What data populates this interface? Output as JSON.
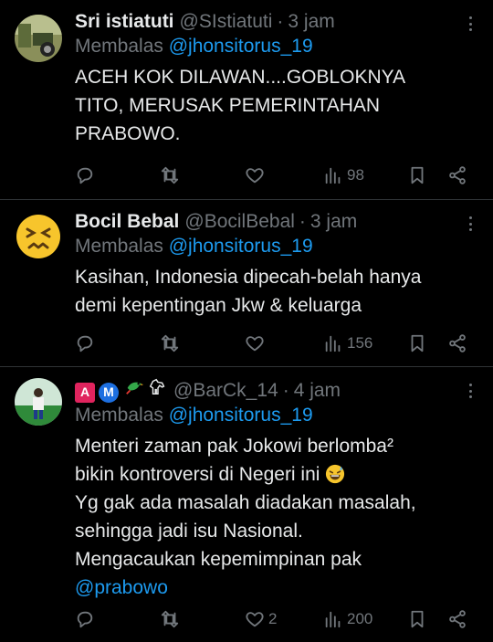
{
  "tweets": [
    {
      "name": "Sri istiatuti",
      "handle": "@SIstiatuti",
      "time": "3 jam",
      "reply_prefix": "Membalas",
      "reply_to": "@jhonsitorus_19",
      "text": "ACEH KOK DILAWAN....GOBLOKNYA\nTITO, MERUSAK PEMERINTAHAN\nPRABOWO.",
      "views": "98",
      "likes": ""
    },
    {
      "name": "Bocil Bebal",
      "handle": "@BocilBebal",
      "time": "3 jam",
      "reply_prefix": "Membalas",
      "reply_to": "@jhonsitorus_19",
      "text": "Kasihan, Indonesia dipecah-belah hanya\ndemi kepentingan Jkw & keluarga",
      "views": "156",
      "likes": ""
    },
    {
      "name_badges": [
        "A",
        "M"
      ],
      "handle": "@BarCk_14",
      "time": "4 jam",
      "reply_prefix": "Membalas",
      "reply_to": "@jhonsitorus_19",
      "text_lines": [
        "Menteri zaman pak Jokowi berlomba²",
        "bikin kontroversi di Negeri ini",
        "Yg gak ada masalah diadakan masalah,",
        "sehingga jadi isu Nasional.",
        "Mengacaukan kepemimpinan pak"
      ],
      "mention": "@prabowo",
      "views": "200",
      "likes": "2"
    }
  ],
  "icons": [
    "reply-icon",
    "retweet-icon",
    "like-icon",
    "views-icon",
    "bookmark-icon",
    "share-icon"
  ],
  "colors": {
    "background": "#000000",
    "text": "#e7e9ea",
    "muted": "#71767b",
    "link": "#1d9bf0",
    "badge_a": "#e0245e",
    "badge_m": "#1d6fe0"
  }
}
